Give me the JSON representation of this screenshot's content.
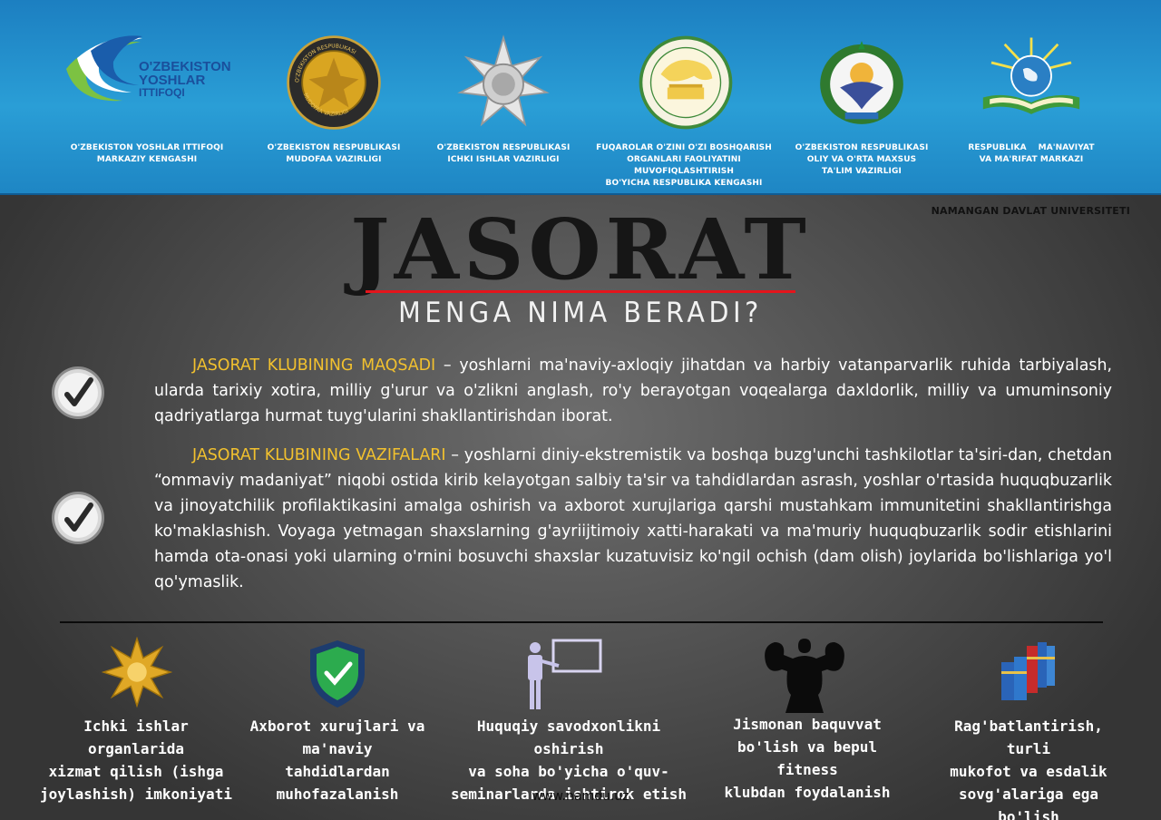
{
  "header": {
    "organizations": [
      {
        "logo": "yoshlar-ittifoqi-logo",
        "logo_text": [
          "O'ZBEKISTON",
          "YOSHLAR",
          "ITTIFOQI"
        ],
        "caption": [
          "O'ZBEKISTON YOSHLAR ITTIFOQI",
          "MARKAZIY KENGASHI"
        ]
      },
      {
        "logo": "mudofaa-emblem",
        "logo_text": [
          "O'ZBEKISTON RESPUBLIKASI",
          "MUDOFAA VAZIRLIGI"
        ],
        "caption": [
          "O'ZBEKISTON RESPUBLIKASI",
          "MUDOFAA VAZIRLIGI"
        ]
      },
      {
        "logo": "ichki-ishlar-star-emblem",
        "caption": [
          "O'ZBEKISTON RESPUBLIKASI",
          "ICHKI ISHLAR VAZIRLIGI"
        ]
      },
      {
        "logo": "fuqarolar-kengashi-emblem",
        "caption": [
          "FUQAROLAR O'ZINI O'ZI BOSHQARISH",
          "ORGANLARI FAOLIYATINI MUVOFIQLASHTIRISH",
          "BO'YICHA RESPUBLIKA KENGASHI"
        ]
      },
      {
        "logo": "state-coat-of-arms",
        "caption": [
          "O'ZBEKISTON RESPUBLIKASI",
          "OLIY VA O'RTA MAXSUS",
          "TA'LIM VAZIRLIGI"
        ]
      },
      {
        "logo": "manaviyat-book-globe-emblem",
        "caption": [
          "RESPUBLIKA    MA'NAVIYAT",
          "VA MA'RIFAT MARKAZI"
        ]
      }
    ]
  },
  "university": "NAMANGAN DAVLAT UNIVERSITETI",
  "title": "JASORAT",
  "subtitle": "MENGA NIMA BERADI?",
  "sections": [
    {
      "icon": "checkmark-icon",
      "highlight": "JASORAT KLUBINING MAQSADI",
      "text": " – yoshlarni ma'naviy-axloqiy jihatdan va harbiy vatanparvarlik ruhida tarbiyalash, ularda tarixiy xotira, milliy g'urur va o'zlikni anglash, ro'y berayotgan voqealarga daxldorlik, milliy va umuminsoniy qadriyatlarga hurmat tuyg'ularini shakllantirishdan iborat."
    },
    {
      "icon": "checkmark-icon",
      "highlight": "JASORAT KLUBINING VAZIFALARI",
      "text": " – yoshlarni diniy-ekstremistik va boshqa buzg'unchi tashkilotlar ta'siri-dan, chetdan “ommaviy madaniyat” niqobi ostida kirib kelayotgan salbiy ta'sir va tahdidlardan asrash, yoshlar o'rtasida huquqbuzarlik va jinoyatchilik profilaktikasini amalga oshirish va axborot xurujlariga qarshi mustahkam immunitetini shakllantirishga ko'maklashish. Voyaga yetmagan shaxslarning g'ayriijtimoiy xatti-harakati va ma'muriy huquqbuzarlik sodir etishlarini hamda ota-onasi yoki ularning o'rnini bosuvchi shaxslar kuzatuvisiz ko'ngil ochish (dam olish) joylarida bo'lishlariga yo'l qo'ymaslik."
    }
  ],
  "features": [
    {
      "icon": "gold-star-icon",
      "label": [
        "Ichki ishlar organlarida",
        "xizmat qilish (ishga",
        "joylashish) imkoniyati"
      ]
    },
    {
      "icon": "shield-check-icon",
      "label": [
        "Axborot xurujlari va",
        "ma'naviy tahdidlardan",
        "muhofazalanish"
      ]
    },
    {
      "icon": "teacher-board-icon",
      "label": [
        "Huquqiy savodxonlikni oshirish",
        "va soha bo'yicha o'quv-",
        "seminarlarda ishtirok etish"
      ]
    },
    {
      "icon": "bodybuilder-icon",
      "label": [
        "Jismonan baquvvat",
        "bo'lish va bepul fitness",
        "klubdan foydalanish"
      ]
    },
    {
      "icon": "books-icon",
      "label": [
        "Rag'batlantirish, turli",
        "mukofot va esdalik",
        "sovg'alariga ega bo'lish"
      ]
    }
  ],
  "website": "www.namdu.uz",
  "colors": {
    "header_blue": "#2a9ed6",
    "highlight_yellow": "#f2c12e",
    "title_red_line": "#e4141c",
    "background_gray": "#555555"
  }
}
